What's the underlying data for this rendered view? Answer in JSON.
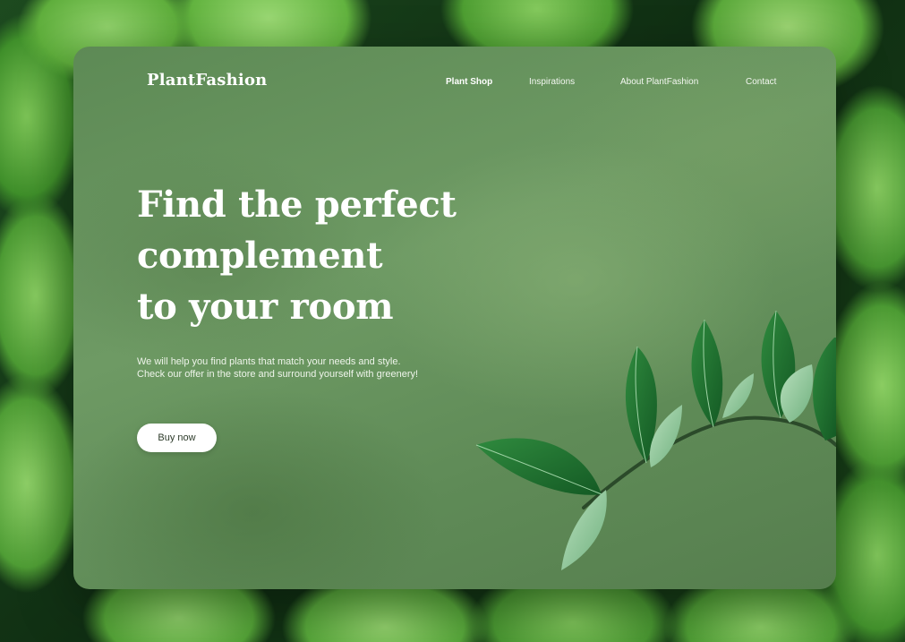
{
  "brand": {
    "name": "PlantFashion"
  },
  "nav": {
    "items": [
      {
        "label": "Plant Shop",
        "active": true
      },
      {
        "label": "Inspirations",
        "active": false
      },
      {
        "label": "About PlantFashion",
        "active": false
      },
      {
        "label": "Contact",
        "active": false
      }
    ]
  },
  "hero": {
    "headline": [
      "Find the perfect",
      "complement",
      "to your room"
    ],
    "description": [
      "We will help you find plants that match your needs and style.",
      "Check our offer in the store and surround yourself with greenery!"
    ],
    "cta_label": "Buy now"
  },
  "colors": {
    "card": "#5f8b57",
    "text": "#ffffff",
    "button_bg": "#ffffff",
    "button_text": "#2d3b2a",
    "leaf_dark": "#1f6b2e",
    "leaf_light": "#8cc79a"
  },
  "icons": {
    "decoration": "plant-branch-illustration"
  }
}
